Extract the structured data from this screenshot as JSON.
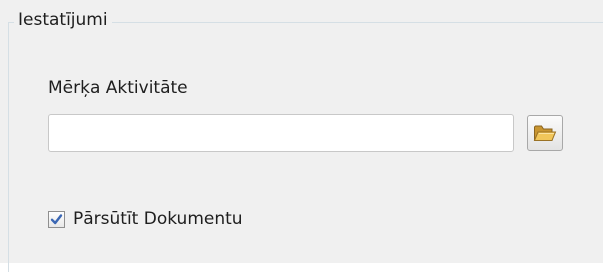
{
  "group": {
    "title": "Iestatījumi"
  },
  "target_activity": {
    "label": "Mērķa Aktivitāte",
    "value": "",
    "placeholder": ""
  },
  "browse_button": {
    "icon": "folder-open-icon"
  },
  "forward_document": {
    "label": "Pārsūtīt Dokumentu",
    "checked": true
  },
  "colors": {
    "background": "#f0f0f0",
    "group_border": "#d5dfe5",
    "check_mark": "#3b67b4",
    "folder_icon": "#e9b84b"
  }
}
